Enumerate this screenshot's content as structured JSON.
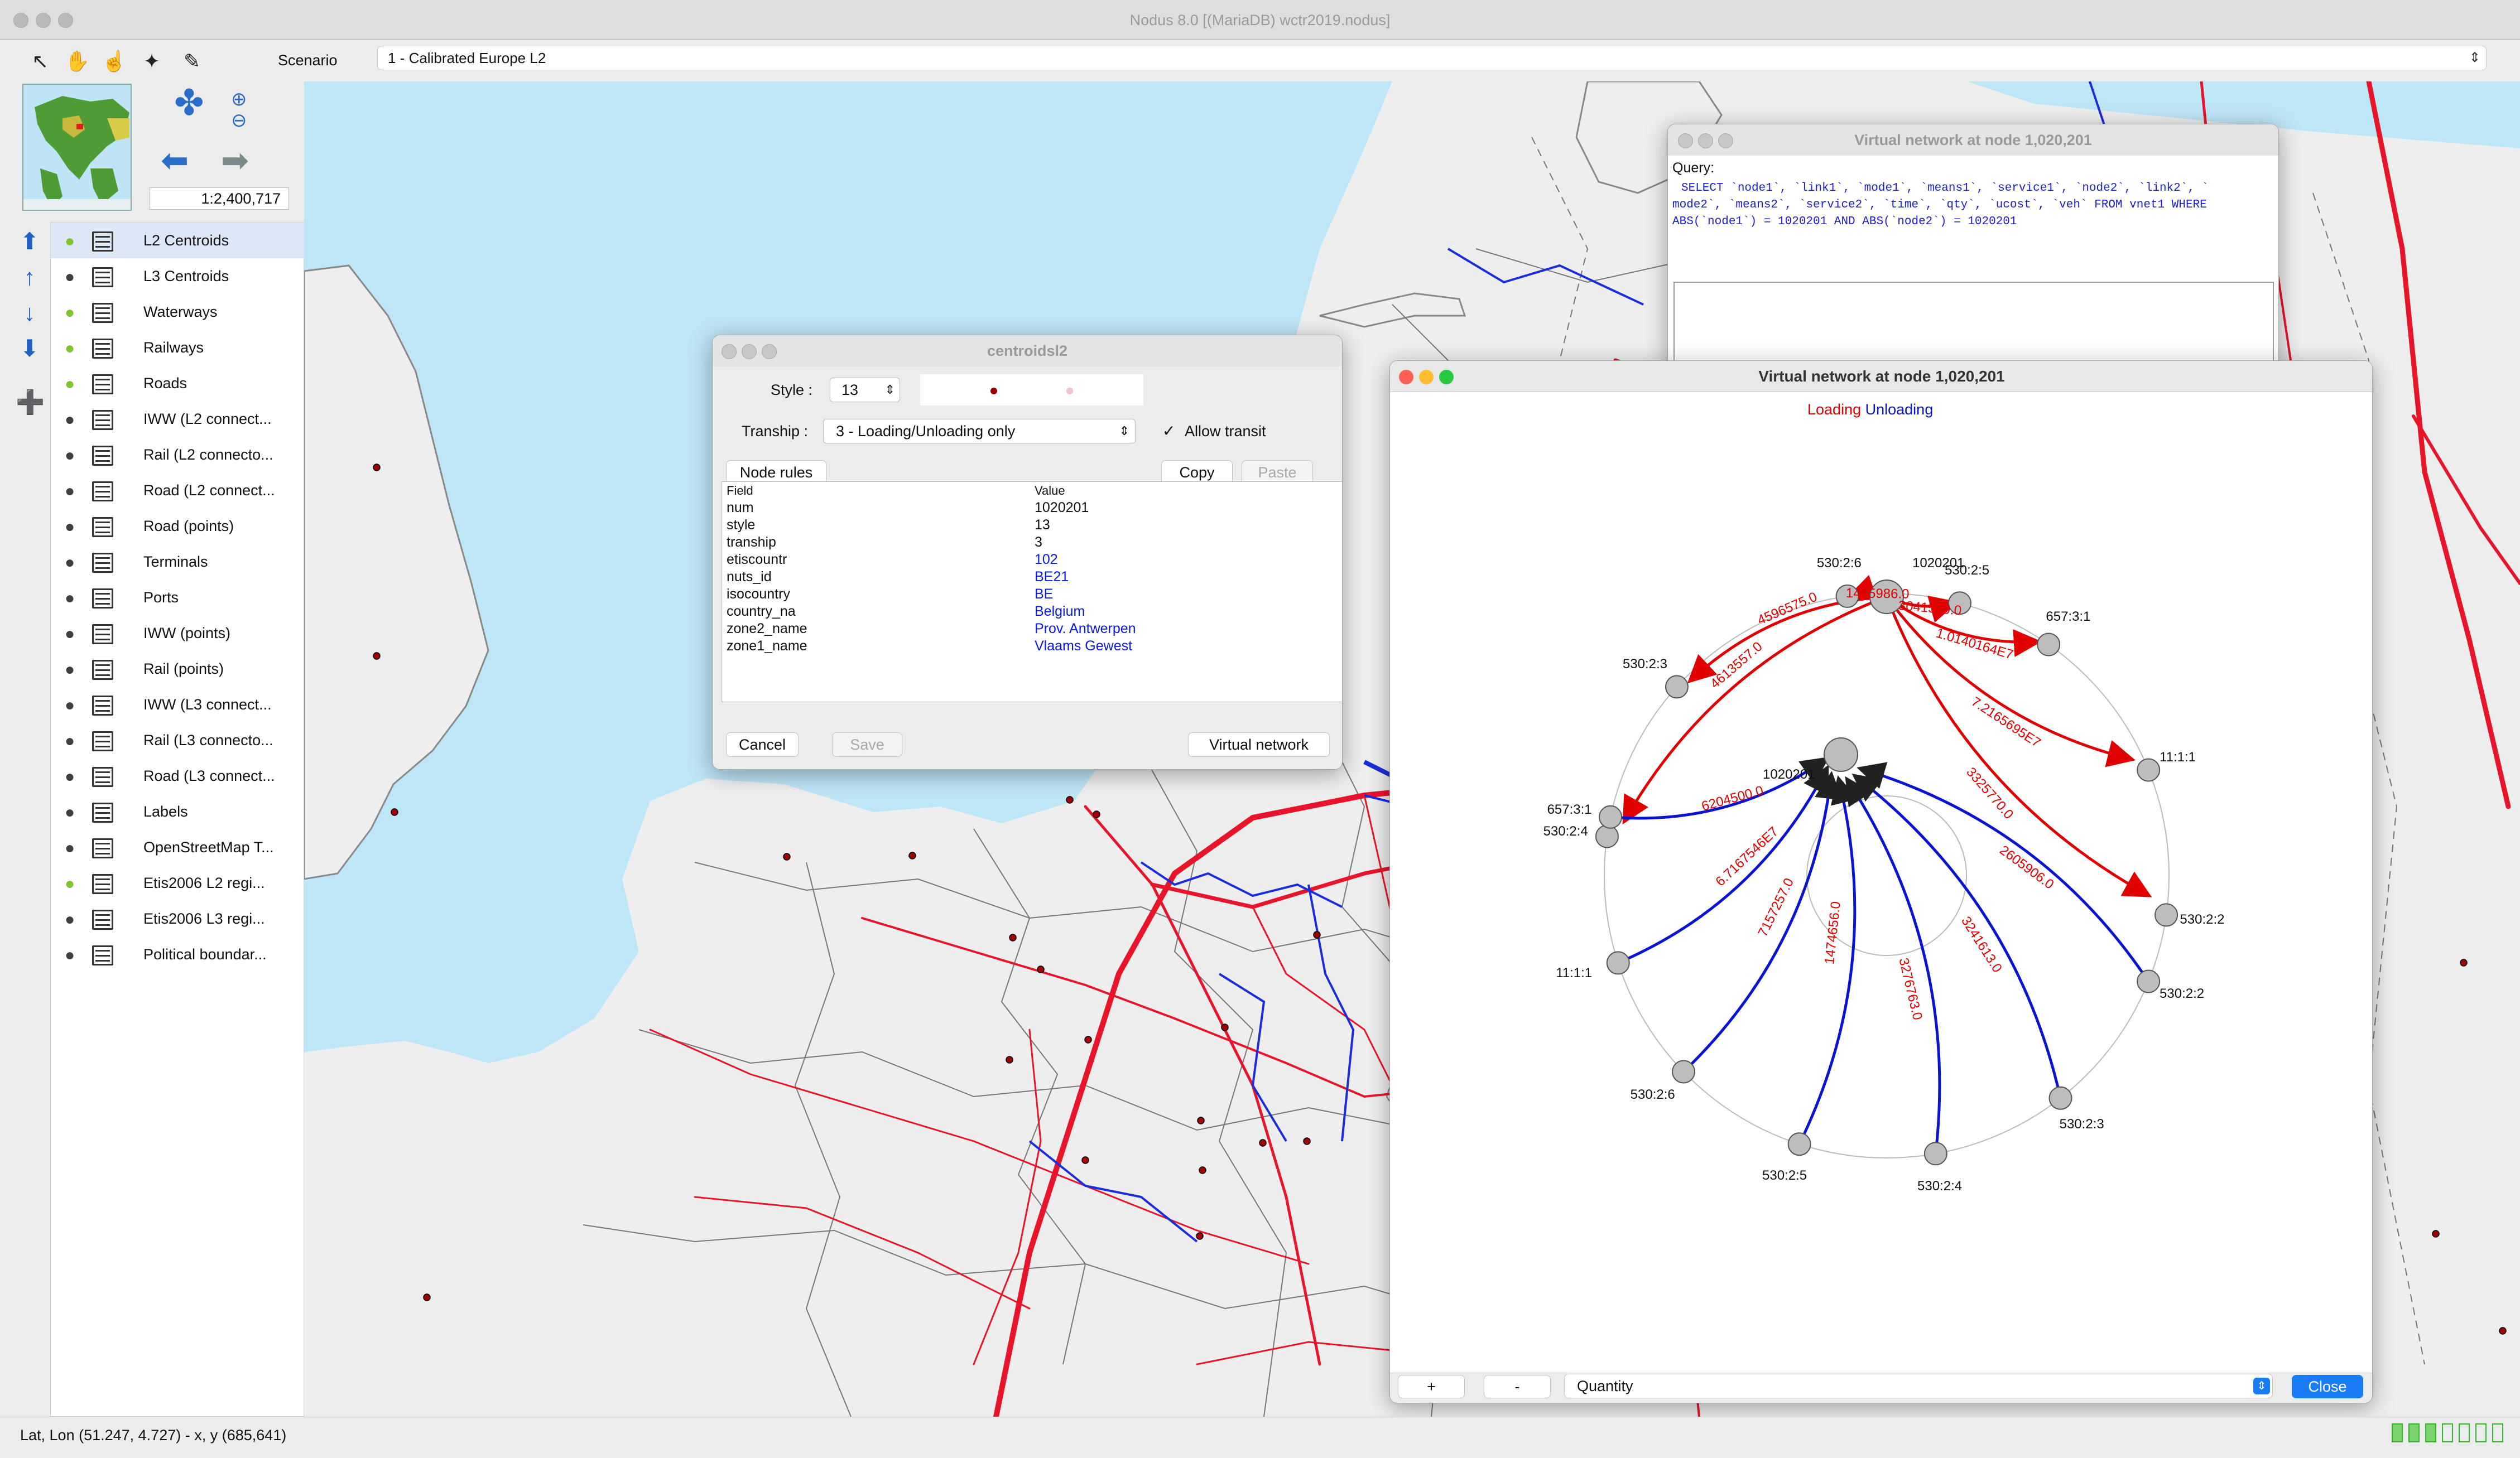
{
  "window": {
    "title": "Nodus 8.0 [(MariaDB) wctr2019.nodus]"
  },
  "toolbar": {
    "scenario_label": "Scenario",
    "scenario_value": "1 - Calibrated Europe L2"
  },
  "overview": {
    "scale": "1:2,400,717"
  },
  "layers": [
    {
      "name": "L2 Centroids",
      "on": true
    },
    {
      "name": "L3 Centroids",
      "on": false
    },
    {
      "name": "Waterways",
      "on": true
    },
    {
      "name": "Railways",
      "on": true
    },
    {
      "name": "Roads",
      "on": true
    },
    {
      "name": "IWW (L2 connect...",
      "on": false
    },
    {
      "name": "Rail (L2 connecto...",
      "on": false
    },
    {
      "name": "Road (L2 connect...",
      "on": false
    },
    {
      "name": "Road (points)",
      "on": false
    },
    {
      "name": "Terminals",
      "on": false
    },
    {
      "name": "Ports",
      "on": false
    },
    {
      "name": "IWW (points)",
      "on": false
    },
    {
      "name": "Rail (points)",
      "on": false
    },
    {
      "name": "IWW (L3 connect...",
      "on": false
    },
    {
      "name": "Rail (L3 connecto...",
      "on": false
    },
    {
      "name": "Road (L3 connect...",
      "on": false
    },
    {
      "name": "Labels",
      "on": false
    },
    {
      "name": "OpenStreetMap T...",
      "on": false
    },
    {
      "name": "Etis2006 L2 regi...",
      "on": true
    },
    {
      "name": "Etis2006 L3 regi...",
      "on": false
    },
    {
      "name": "Political boundar...",
      "on": false
    }
  ],
  "status": {
    "coords": "Lat, Lon (51.247, 4.727) - x, y (685,641)"
  },
  "query_window": {
    "title": "Virtual network at node 1,020,201",
    "label": "Query:",
    "line1": "SELECT `node1`, `link1`, `mode1`, `means1`, `service1`, `node2`, `link2`, `",
    "line2": "mode2`, `means2`, `service2`, `time`, `qty`, `ucost`, `veh` FROM vnet1 WHERE",
    "line3": "ABS(`node1`) = 1020201 AND ABS(`node2`) = 1020201"
  },
  "centroid_dialog": {
    "title": "centroidsl2",
    "style_label": "Style :",
    "style_value": "13",
    "tranship_label": "Tranship :",
    "tranship_value": "3 - Loading/Unloading only",
    "allow_transit": "Allow transit",
    "node_rules": "Node rules",
    "copy": "Copy",
    "paste": "Paste",
    "col_field": "Field",
    "col_value": "Value",
    "fields": [
      {
        "field": "num",
        "value": "1020201",
        "link": false
      },
      {
        "field": "style",
        "value": "13",
        "link": false
      },
      {
        "field": "tranship",
        "value": "3",
        "link": false
      },
      {
        "field": "etiscountr",
        "value": "102",
        "link": true
      },
      {
        "field": "nuts_id",
        "value": "BE21",
        "link": true
      },
      {
        "field": "isocountry",
        "value": "BE",
        "link": true
      },
      {
        "field": "country_na",
        "value": "Belgium",
        "link": true
      },
      {
        "field": "zone2_name",
        "value": "Prov. Antwerpen",
        "link": true
      },
      {
        "field": "zone1_name",
        "value": "Vlaams Gewest",
        "link": true
      }
    ],
    "cancel": "Cancel",
    "save": "Save",
    "virtual_network": "Virtual network"
  },
  "vnet_window": {
    "title": "Virtual network at node 1,020,201",
    "legend_loading": "Loading",
    "legend_unloading": "Unloading",
    "center_label_top": "1020201",
    "center_label_bottom": "1020201",
    "loading_color": "#e00000",
    "unloading_color": "#0a14d0",
    "loading_edges": [
      {
        "node": "530:2:6",
        "value": "1405986.0"
      },
      {
        "node": "530:2:5",
        "value": "3041539.0"
      },
      {
        "node": "657:3:1",
        "value": "1.0140164E7"
      },
      {
        "node": "11:1:1",
        "value": "7.2165695E7"
      },
      {
        "node": "530:2:2",
        "value": "3325770.0"
      },
      {
        "node": "530:2:3",
        "value": "4596575.0"
      },
      {
        "node": "530:2:4",
        "value": "4613557.0"
      }
    ],
    "unloading_edges": [
      {
        "node": "657:3:1",
        "value": "6204500.0"
      },
      {
        "node": "11:1:1",
        "value": "6.7167546E7"
      },
      {
        "node": "530:2:6",
        "value": "7157257.0"
      },
      {
        "node": "530:2:5",
        "value": "1474656.0"
      },
      {
        "node": "530:2:4",
        "value": "3276763.0"
      },
      {
        "node": "530:2:3",
        "value": "3241613.0"
      },
      {
        "node": "530:2:2",
        "value": "2605906.0"
      }
    ],
    "plus": "+",
    "minus": "-",
    "quantity_select": "Quantity",
    "close": "Close"
  },
  "colors": {
    "sea": "#bde6f7",
    "land": "#eeeeee",
    "rail": "#e8142a",
    "water": "#1a2ce0",
    "accent": "#1a7cf5"
  }
}
